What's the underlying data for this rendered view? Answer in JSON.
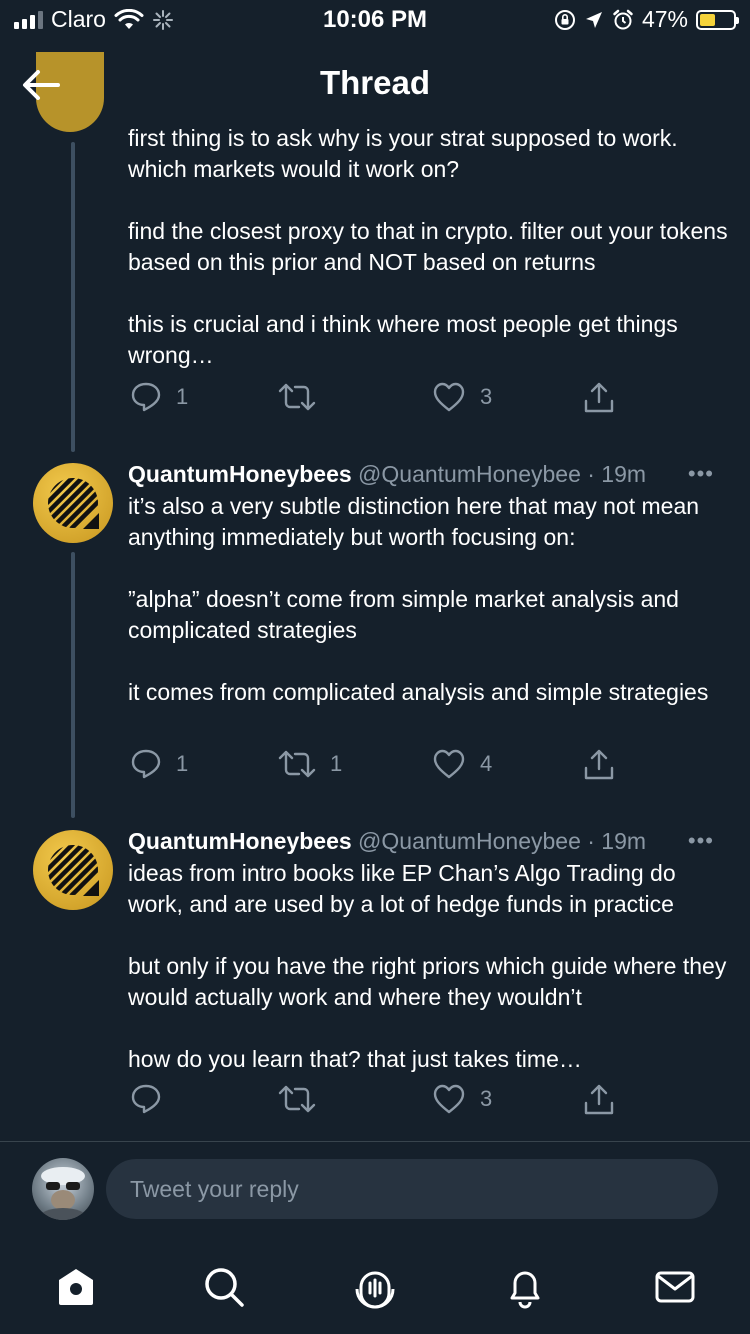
{
  "status_bar": {
    "carrier": "Claro",
    "time": "10:06 PM",
    "battery_percent": "47%",
    "battery_level": 0.47,
    "icons": [
      "signal-icon",
      "wifi-icon",
      "activity-icon",
      "orientation-lock-icon",
      "location-icon",
      "alarm-icon",
      "battery-icon"
    ]
  },
  "header": {
    "title": "Thread",
    "back_icon": "arrow-left-icon"
  },
  "tweets": [
    {
      "paragraphs": [
        "first thing is to ask why is your strat supposed to work. which markets would it work on?",
        "find the closest proxy to that in crypto. filter out your tokens based on this prior and NOT based on returns",
        "this is crucial and i think where most people get things wrong…"
      ],
      "replies": "1",
      "retweets": "",
      "likes": "3"
    },
    {
      "name": "QuantumHoneybees",
      "handle": "@QuantumHoneybee · 19m",
      "more": "•••",
      "paragraphs": [
        "it’s also a very subtle distinction here that may not mean anything immediately but worth focusing on:",
        "”alpha” doesn’t come from simple market analysis and complicated strategies",
        "it comes from complicated analysis and simple strategies"
      ],
      "replies": "1",
      "retweets": "1",
      "likes": "4"
    },
    {
      "name": "QuantumHoneybees",
      "handle": "@QuantumHoneybee · 19m",
      "more": "•••",
      "paragraphs": [
        "ideas from intro books like EP Chan’s Algo Trading do work, and are used by a lot of hedge funds in practice",
        "but only if you have the right priors which guide where they would actually work and where they wouldn’t",
        "how do you learn that? that just takes time…"
      ],
      "replies": "",
      "retweets": "",
      "likes": "3"
    }
  ],
  "reply": {
    "placeholder": "Tweet your reply"
  },
  "tabbar": {
    "items": [
      "home-icon",
      "search-icon",
      "spaces-icon",
      "notifications-icon",
      "messages-icon"
    ]
  },
  "colors": {
    "background": "#15202b",
    "text": "#ffffff",
    "muted": "#8b98a5",
    "avatar": "#e2b436",
    "battery": "#f5d33a"
  }
}
